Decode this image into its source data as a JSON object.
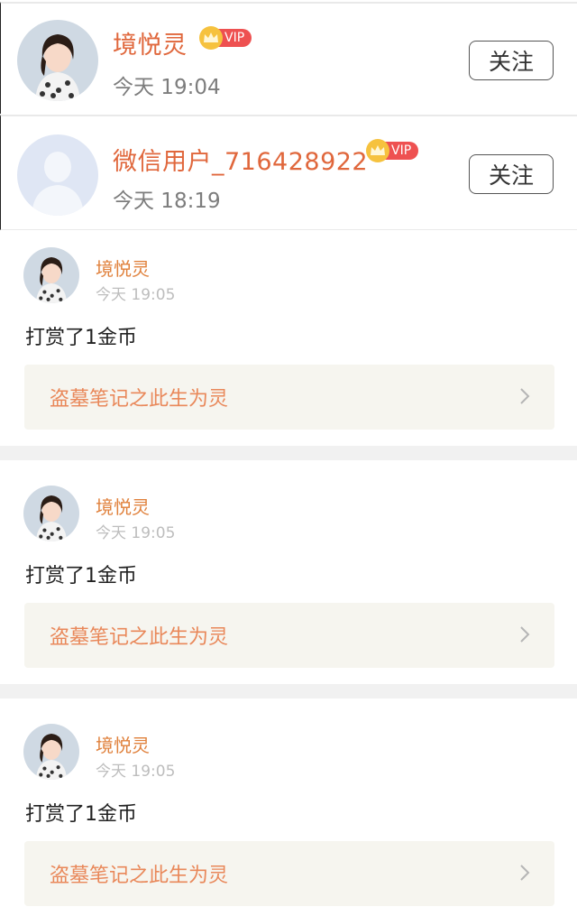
{
  "follow_list": [
    {
      "name": "境悦灵",
      "vip_label": "VIP",
      "time": "今天 19:04",
      "follow_label": "关注"
    },
    {
      "name": "微信用户_716428922",
      "vip_label": "VIP",
      "time": "今天 18:19",
      "follow_label": "关注"
    }
  ],
  "reward_cards": [
    {
      "name": "境悦灵",
      "time": "今天 19:05",
      "message": "打赏了1金币",
      "book_title": "盗墓笔记之此生为灵"
    },
    {
      "name": "境悦灵",
      "time": "今天 19:05",
      "message": "打赏了1金币",
      "book_title": "盗墓笔记之此生为灵"
    },
    {
      "name": "境悦灵",
      "time": "今天 19:05",
      "message": "打赏了1金币",
      "book_title": "盗墓笔记之此生为灵"
    }
  ],
  "colors": {
    "accent": "#e0673c",
    "vip": "#ee5151",
    "crown": "#f6c23e",
    "book_bg": "#f6f5ef"
  },
  "icons": {
    "avatar_photo": "user-photo-avatar",
    "avatar_default": "default-avatar-icon",
    "chevron": "chevron-right-icon",
    "crown": "crown-icon"
  }
}
